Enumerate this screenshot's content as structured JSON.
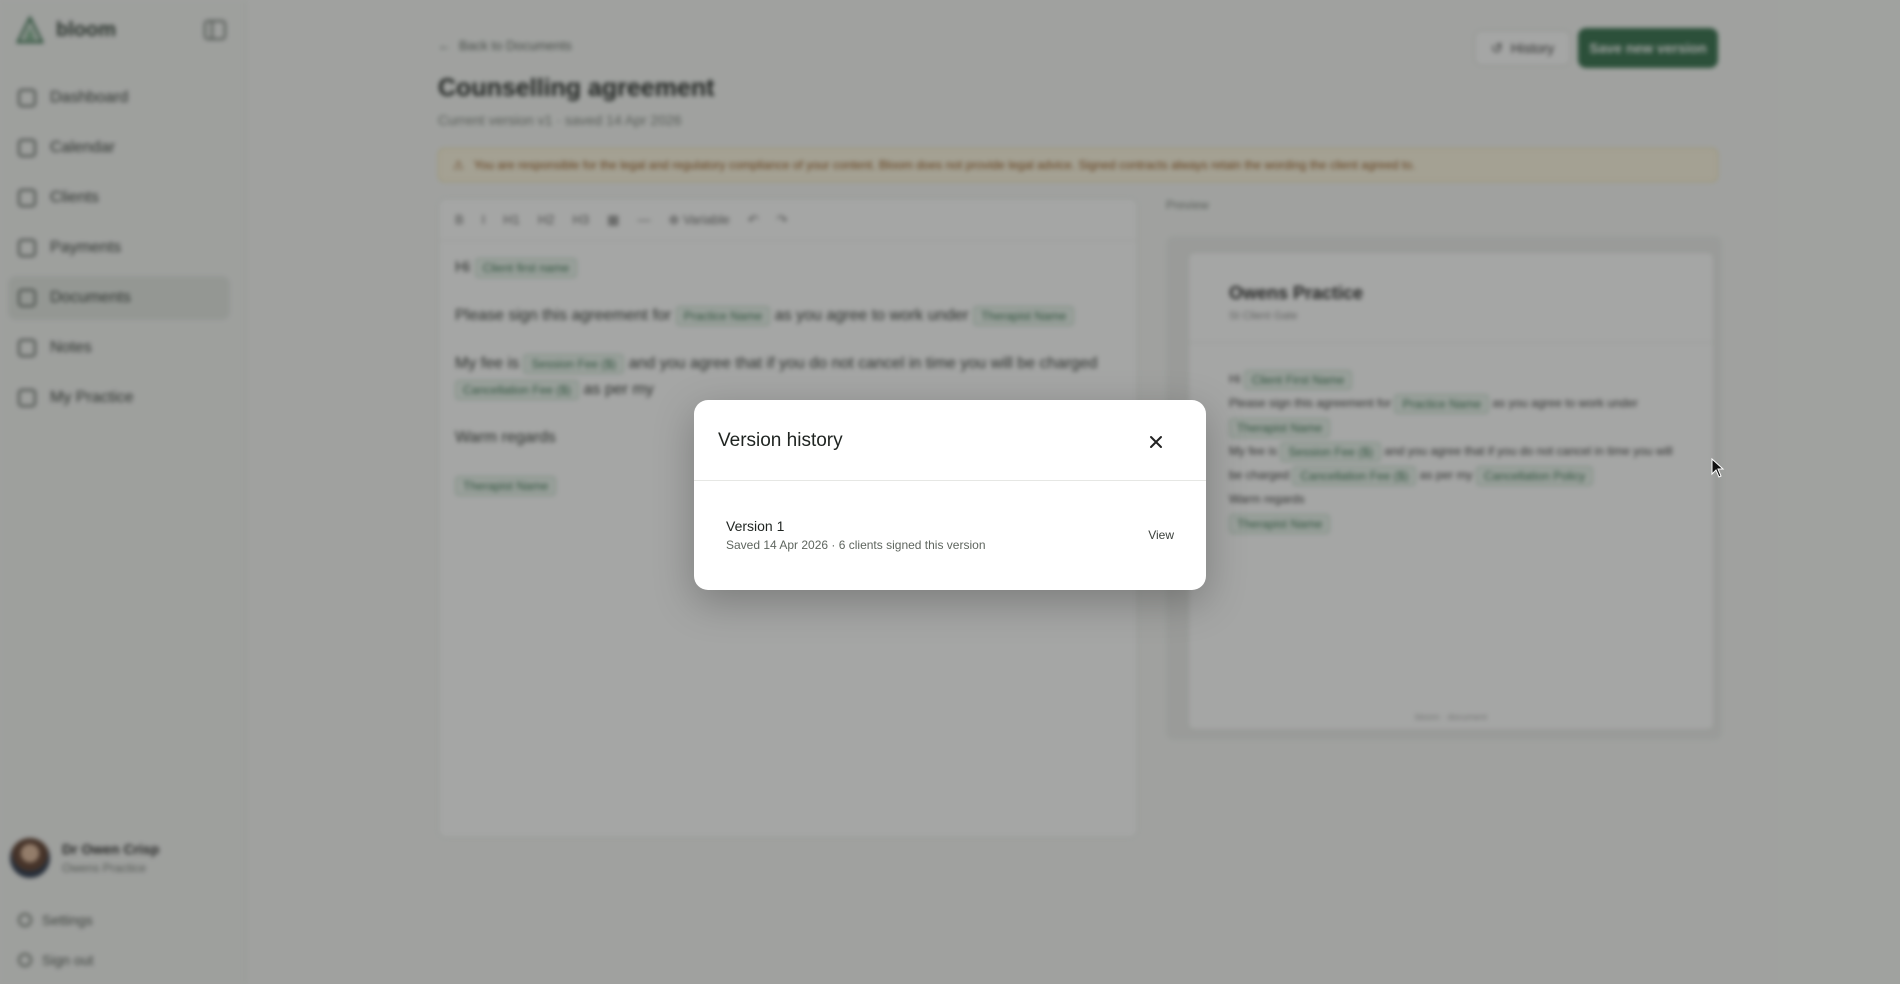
{
  "app": {
    "name": "bloom"
  },
  "sidebar": {
    "items": [
      {
        "label": "Dashboard"
      },
      {
        "label": "Calendar"
      },
      {
        "label": "Clients"
      },
      {
        "label": "Payments"
      },
      {
        "label": "Documents"
      },
      {
        "label": "Notes"
      },
      {
        "label": "My Practice"
      }
    ],
    "profile": {
      "name": "Dr Owen Crisp",
      "subtitle": "Owens Practice"
    },
    "settings_label": "Settings",
    "signout_label": "Sign out"
  },
  "header": {
    "back_label": "Back to Documents",
    "title": "Counselling agreement",
    "subtitle": "Current version v1 · saved 14 Apr 2026",
    "history_label": "History",
    "save_label": "Save new version"
  },
  "warning": {
    "text": "You are responsible for the legal and regulatory compliance of your content. Bloom does not provide legal advice. Signed contracts always retain the wording the client agreed to."
  },
  "editor": {
    "toolbar": [
      "B",
      "I",
      "H1",
      "H2",
      "H3",
      "▦",
      "—",
      "⊕ Variable",
      "↶",
      "↷"
    ],
    "greeting": "Hi",
    "greeting_chip": "Client first name",
    "p1_a": "Please sign this agreement for",
    "p1_chip1": "Practice Name",
    "p1_b": "as you agree to work under",
    "p1_chip2": "Therapist Name",
    "p2_a": "My fee is",
    "p2_chip1": "Session Fee ($)",
    "p2_b": "and you agree that if you do not cancel in time you will be charged",
    "p2_chip2": "Cancellation Fee ($)",
    "p2_c": "as per my",
    "regards": "Warm regards",
    "signature_chip": "Therapist Name"
  },
  "preview": {
    "label": "Preview",
    "practice_name": "Owens Practice",
    "practice_sub": "St Client Gate",
    "greeting": "Hi",
    "greeting_chip": "Client First Name",
    "line1": "Please sign this agreement for",
    "line1_chip": "Practice Name",
    "line1_b": "as you agree to work under",
    "line1_chip2": "Therapist Name",
    "line2": "My fee is",
    "line2_chip": "Session Fee ($)",
    "line2_b": "and you agree that if you do not cancel in time you will be charged",
    "line2_chip2": "Cancellation Fee ($)",
    "line2_c": "as per my",
    "line2_chip3": "Cancellation Policy",
    "regards": "Warm regards",
    "signature_chip": "Therapist Name",
    "footer": "bloom · document"
  },
  "modal": {
    "title": "Version history",
    "versions": [
      {
        "name": "Version 1",
        "meta": "Saved 14 Apr 2026 · 6 clients signed this version",
        "action": "View"
      }
    ]
  },
  "colors": {
    "brand": "#2f6b47",
    "overlay": "rgba(40,44,40,0.42)"
  }
}
